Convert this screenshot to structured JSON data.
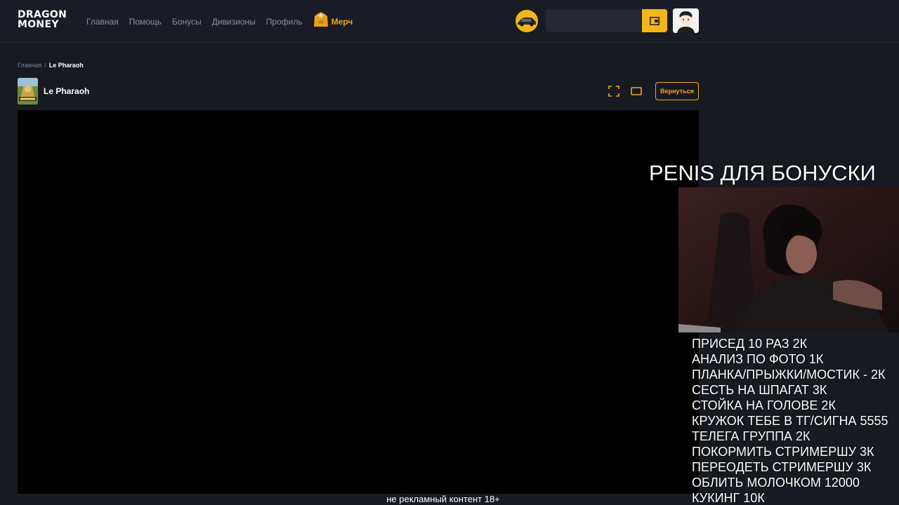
{
  "header": {
    "logo_line1": "DRAGON",
    "logo_line2": "MONEY",
    "nav": [
      {
        "label": "Главная"
      },
      {
        "label": "Помощь"
      },
      {
        "label": "Бонусы"
      },
      {
        "label": "Дивизионы"
      },
      {
        "label": "Профиль"
      }
    ],
    "merch_label": "Мерч",
    "search_value": "",
    "accent": "#f2b51a"
  },
  "breadcrumb": {
    "home": "Главная",
    "separator": "/",
    "current": "Le Pharaoh"
  },
  "game": {
    "title": "Le Pharaoh",
    "back_label": "Вернуться"
  },
  "overlay": {
    "title": "PENIS ДЛЯ БОНУСКИ",
    "items": [
      "ПРИСЕД 10 РАЗ 2К",
      "АНАЛИЗ ПО ФОТО 1К",
      "ПЛАНКА/ПРЫЖКИ/МОСТИК - 2К",
      "СЕСТЬ НА ШПАГАТ 3К",
      "СТОЙКА НА ГОЛОВЕ 2К",
      "КРУЖОК ТЕБЕ В ТГ/СИГНА 5555",
      "ТЕЛЕГА ГРУППА 2К",
      "ПОКОРМИТЬ СТРИМЕРШУ 3К",
      "ПЕРЕОДЕТЬ СТРИМЕРШУ 3К",
      "ОБЛИТЬ МОЛОЧКОМ 12000",
      "КУКИНГ 10К"
    ],
    "disclaimer": "не рекламный контент 18+"
  }
}
